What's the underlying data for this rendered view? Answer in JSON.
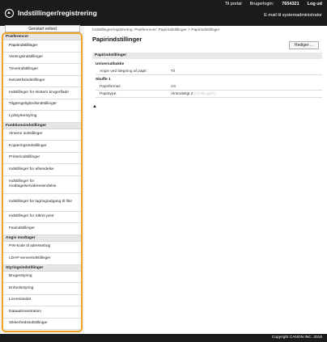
{
  "header": {
    "app_title": "Indstillinger/registrering",
    "links": [
      "Til portal",
      "Brugerlogin:",
      "7654321",
      "Log ud"
    ],
    "email_link": "E-mail til systemadministrator"
  },
  "sidebar": {
    "start_button": "Genstart enhed",
    "groups": [
      {
        "header": "Præferencer",
        "items": [
          "Papirindstillinger",
          "Visningsindstillinger",
          "Timerindstillinger",
          "Netværksindstillinger",
          "Indstillinger for ekstern brugerflade",
          "Tilgængelighedsindstillinger",
          "Lydstyrkestyring"
        ]
      },
      {
        "header": "Funktionsindstillinger",
        "items": [
          "Almene indstillinger",
          "Kopieringsindstillinger",
          "Printerindstillinger",
          "Indstillinger for afsendelse",
          "Indstillinger for modtagelse/videresendelse",
          "Indstillinger for lagring/adgang til filer",
          "Indstillinger for Sikret print",
          "Faxindstillinger"
        ]
      },
      {
        "header": "Angiv modtager",
        "items": [
          "PIN-kode til adressebog",
          "LDAP-serverindstillinger"
        ]
      },
      {
        "header": "Styringsindstillinger",
        "items": [
          "Brugerstyring",
          "Enhedsstyring",
          "Licens/andet",
          "Dataadministration",
          "Sikkerhedsindstillinger"
        ]
      }
    ]
  },
  "main": {
    "breadcrumb": "Indstillinger/registrering: Præferencer: Papirindstillinger > Papirindstillinger",
    "title": "Papirindstillinger",
    "edit_button": "Rediger ...",
    "section_title": "Papirindstillinger",
    "universal_title": "Universalbakke",
    "universal_rows": [
      {
        "key": "Angiv ved ilægning af papir:",
        "value": "Til"
      }
    ],
    "drawer_title": "Skuffe 1",
    "drawer_rows": [
      {
        "key": "Papirformat:",
        "value": "A4"
      },
      {
        "key": "Papirtype:",
        "value": "Almindeligt 2",
        "value_faded": "(75-90 g/m²)"
      }
    ],
    "up_arrow": "▲"
  },
  "footer": {
    "copyright": "Copyright CANON INC. 2016"
  }
}
